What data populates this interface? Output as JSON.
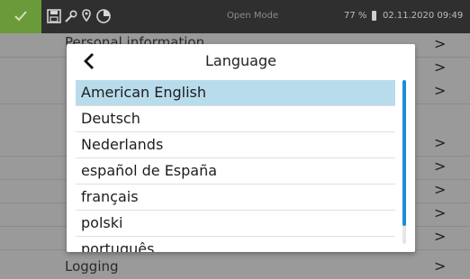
{
  "status_bar": {
    "mode": "Open Mode",
    "battery": "77 %",
    "datetime": "02.11.2020 09:49",
    "icons": [
      "check-icon",
      "save-icon",
      "wrench-icon",
      "location-pin-icon",
      "clock-icon"
    ],
    "colors": {
      "check_bg": "#6b9a3a",
      "bar_bg": "#2f2f2f"
    }
  },
  "background_menu": {
    "partial_label": "Personal information",
    "bottom_label": "Logging",
    "chevron": ">"
  },
  "dialog": {
    "back_icon": "chevron-left-icon",
    "title": "Language",
    "items": [
      {
        "label": "American English",
        "selected": true
      },
      {
        "label": "Deutsch"
      },
      {
        "label": "Nederlands"
      },
      {
        "label": "español de España"
      },
      {
        "label": "français"
      },
      {
        "label": "polski"
      },
      {
        "label": "português"
      }
    ],
    "colors": {
      "selected": "#b8dcec",
      "scrollbar": "#1a8ed8"
    }
  }
}
